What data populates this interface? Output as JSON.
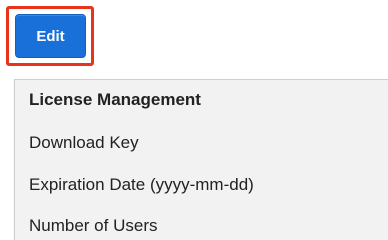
{
  "toolbar": {
    "edit_label": "Edit"
  },
  "dropdown": {
    "header": "License Management",
    "items": [
      {
        "label": "Download Key"
      },
      {
        "label": "Expiration Date (yyyy-mm-dd)"
      },
      {
        "label": "Number of Users"
      }
    ]
  },
  "colors": {
    "button_bg": "#1870d8",
    "highlight_border": "#e8341c",
    "menu_bg": "#f2f2f2"
  }
}
